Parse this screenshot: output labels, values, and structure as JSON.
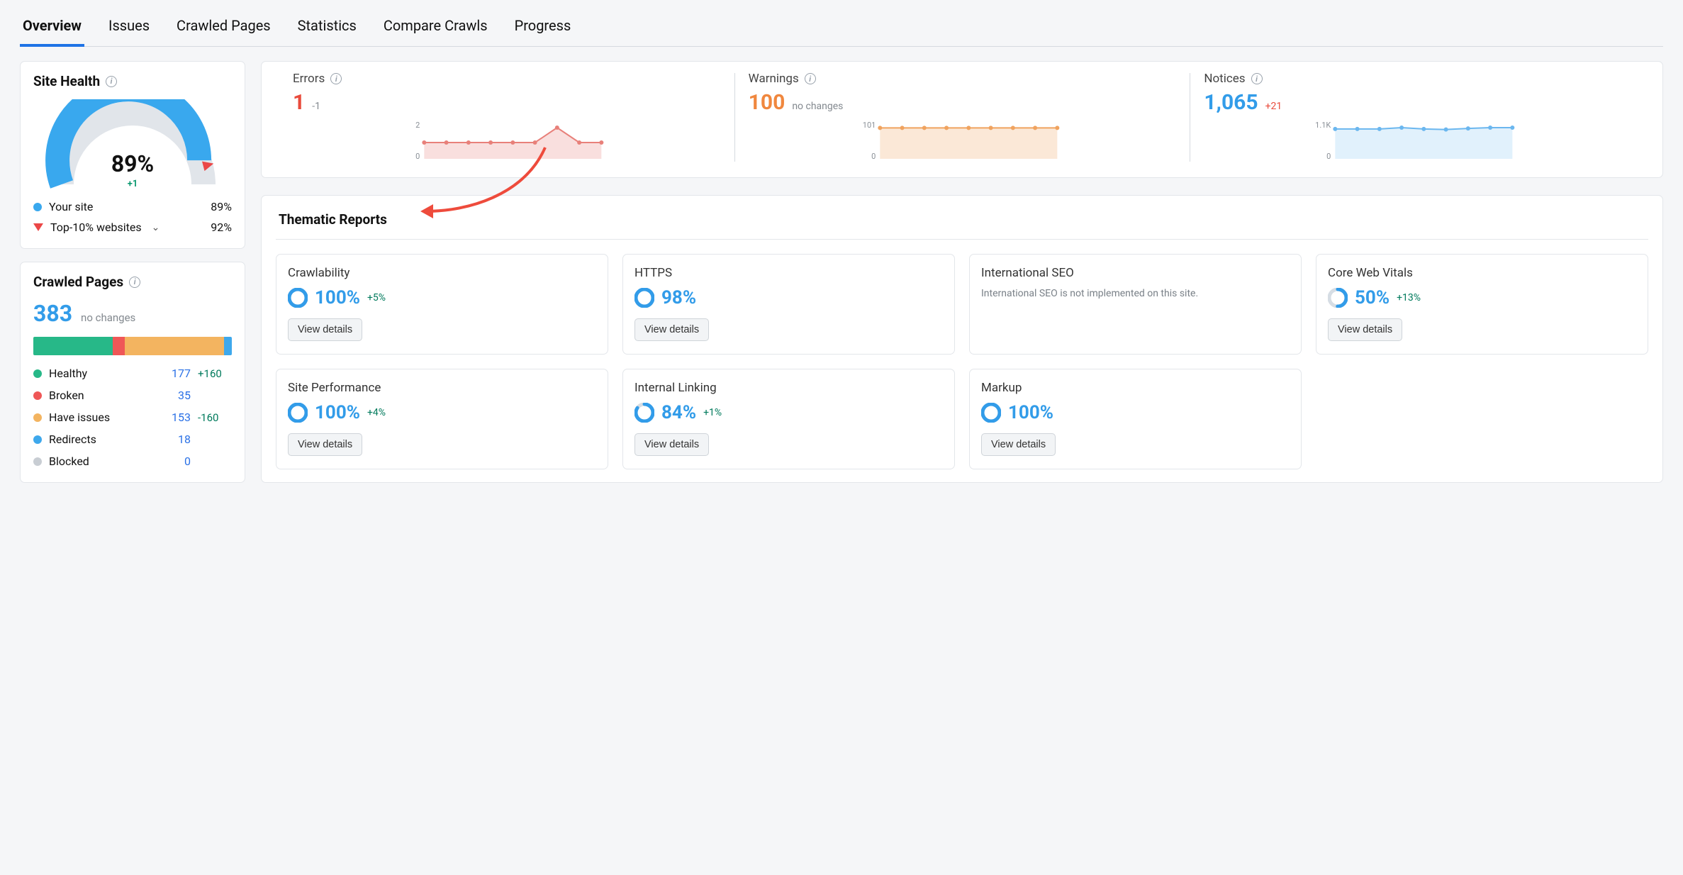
{
  "tabs": [
    "Overview",
    "Issues",
    "Crawled Pages",
    "Statistics",
    "Compare Crawls",
    "Progress"
  ],
  "activeTab": 0,
  "siteHealth": {
    "title": "Site Health",
    "value": "89%",
    "delta": "+1",
    "percent": 89,
    "legend": {
      "site": {
        "label": "Your site",
        "value": "89%",
        "color": "#39a8ee"
      },
      "top10": {
        "label": "Top-10% websites",
        "value": "92%"
      }
    }
  },
  "crawledPages": {
    "title": "Crawled Pages",
    "total": "383",
    "change": "no changes",
    "segments": [
      {
        "color": "#27b888",
        "pct": 40
      },
      {
        "color": "#ef5757",
        "pct": 6
      },
      {
        "color": "#f3b460",
        "pct": 50
      },
      {
        "color": "#3ea8ec",
        "pct": 4
      }
    ],
    "cats": [
      {
        "name": "Healthy",
        "color": "#27b888",
        "count": "177",
        "delta": "+160"
      },
      {
        "name": "Broken",
        "color": "#ef5757",
        "count": "35",
        "delta": ""
      },
      {
        "name": "Have issues",
        "color": "#f3b460",
        "count": "153",
        "delta": "-160"
      },
      {
        "name": "Redirects",
        "color": "#3ea8ec",
        "count": "18",
        "delta": ""
      },
      {
        "name": "Blocked",
        "color": "#c8cdd3",
        "count": "0",
        "delta": ""
      }
    ]
  },
  "metrics": {
    "errors": {
      "label": "Errors",
      "value": "1",
      "delta": "-1",
      "deltaClass": "",
      "numClass": "err",
      "ymax": "2",
      "ymin": "0"
    },
    "warnings": {
      "label": "Warnings",
      "value": "100",
      "delta": "no changes",
      "deltaClass": "",
      "numClass": "warn",
      "ymax": "101",
      "ymin": "0"
    },
    "notices": {
      "label": "Notices",
      "value": "1,065",
      "delta": "+21",
      "deltaClass": "pos-red",
      "numClass": "note",
      "ymax": "1.1K",
      "ymin": "0"
    }
  },
  "chart_data": [
    {
      "type": "line",
      "name": "Errors",
      "x": [
        1,
        2,
        3,
        4,
        5,
        6,
        7,
        8,
        9
      ],
      "values": [
        1,
        1,
        1,
        1,
        1,
        1,
        2,
        1,
        1
      ],
      "ylim": [
        0,
        2
      ],
      "xlabel": "",
      "ylabel": "",
      "fillTo": 0,
      "stroke": "#e8807a",
      "fill": "rgba(232,128,122,0.25)"
    },
    {
      "type": "line",
      "name": "Warnings",
      "x": [
        1,
        2,
        3,
        4,
        5,
        6,
        7,
        8,
        9
      ],
      "values": [
        100,
        100,
        100,
        100,
        100,
        100,
        100,
        100,
        100
      ],
      "ylim": [
        0,
        101
      ],
      "xlabel": "",
      "ylabel": "",
      "fillTo": 0,
      "stroke": "#f0a35f",
      "fill": "rgba(240,163,95,0.25)"
    },
    {
      "type": "line",
      "name": "Notices",
      "x": [
        1,
        2,
        3,
        4,
        5,
        6,
        7,
        8,
        9
      ],
      "values": [
        1050,
        1050,
        1050,
        1100,
        1050,
        1030,
        1070,
        1100,
        1100
      ],
      "ylim": [
        0,
        1100
      ],
      "xlabel": "",
      "ylabel": "",
      "fillTo": 0,
      "stroke": "#6bb7ef",
      "fill": "rgba(107,183,239,0.20)"
    }
  ],
  "thematic": {
    "title": "Thematic Reports",
    "cards": [
      {
        "title": "Crawlability",
        "pct": "100%",
        "p": 100,
        "delta": "+5%"
      },
      {
        "title": "HTTPS",
        "pct": "98%",
        "p": 98,
        "delta": ""
      },
      {
        "title": "International SEO",
        "note": "International SEO is not implemented on this site."
      },
      {
        "title": "Core Web Vitals",
        "pct": "50%",
        "p": 50,
        "delta": "+13%"
      },
      {
        "title": "Site Performance",
        "pct": "100%",
        "p": 100,
        "delta": "+4%"
      },
      {
        "title": "Internal Linking",
        "pct": "84%",
        "p": 84,
        "delta": "+1%"
      },
      {
        "title": "Markup",
        "pct": "100%",
        "p": 100,
        "delta": ""
      }
    ],
    "btn": "View details"
  }
}
